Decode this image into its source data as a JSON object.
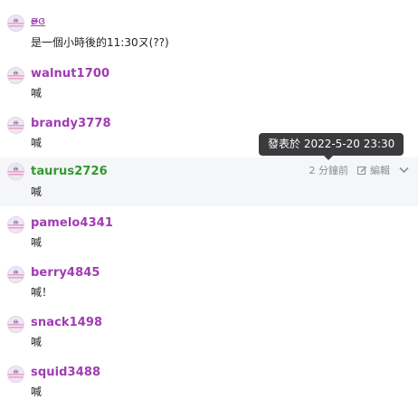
{
  "comments": [
    {
      "name": "ʚ̴̶̷̷ɞ",
      "text": "是一個小時後的11:30ㄡ(??)",
      "name_color": "purple",
      "underline": true
    },
    {
      "name": "walnut1700",
      "text": "喊",
      "name_color": "purple"
    },
    {
      "name": "brandy3778",
      "text": "喊",
      "name_color": "purple"
    },
    {
      "name": "taurus2726",
      "text": "喊",
      "name_color": "green",
      "time": "2 分鐘前",
      "edit_label": "編輯"
    },
    {
      "name": "pamelo4341",
      "text": "喊",
      "name_color": "purple"
    },
    {
      "name": "berry4845",
      "text": "喊！",
      "name_color": "purple"
    },
    {
      "name": "snack1498",
      "text": "喊",
      "name_color": "purple"
    },
    {
      "name": "squid3488",
      "text": "喊",
      "name_color": "purple"
    }
  ],
  "tooltip": {
    "text": "發表於 2022-5-20 23:30"
  },
  "colors": {
    "purple_name": "#a13bb3",
    "green_name": "#2f9a2f",
    "hover_bg": "#f5f6f8",
    "tooltip_bg": "#3b3b3d"
  },
  "icons": {
    "avatar": "avatar-face-icon",
    "edit": "edit-icon",
    "chevron": "chevron-down-icon"
  }
}
